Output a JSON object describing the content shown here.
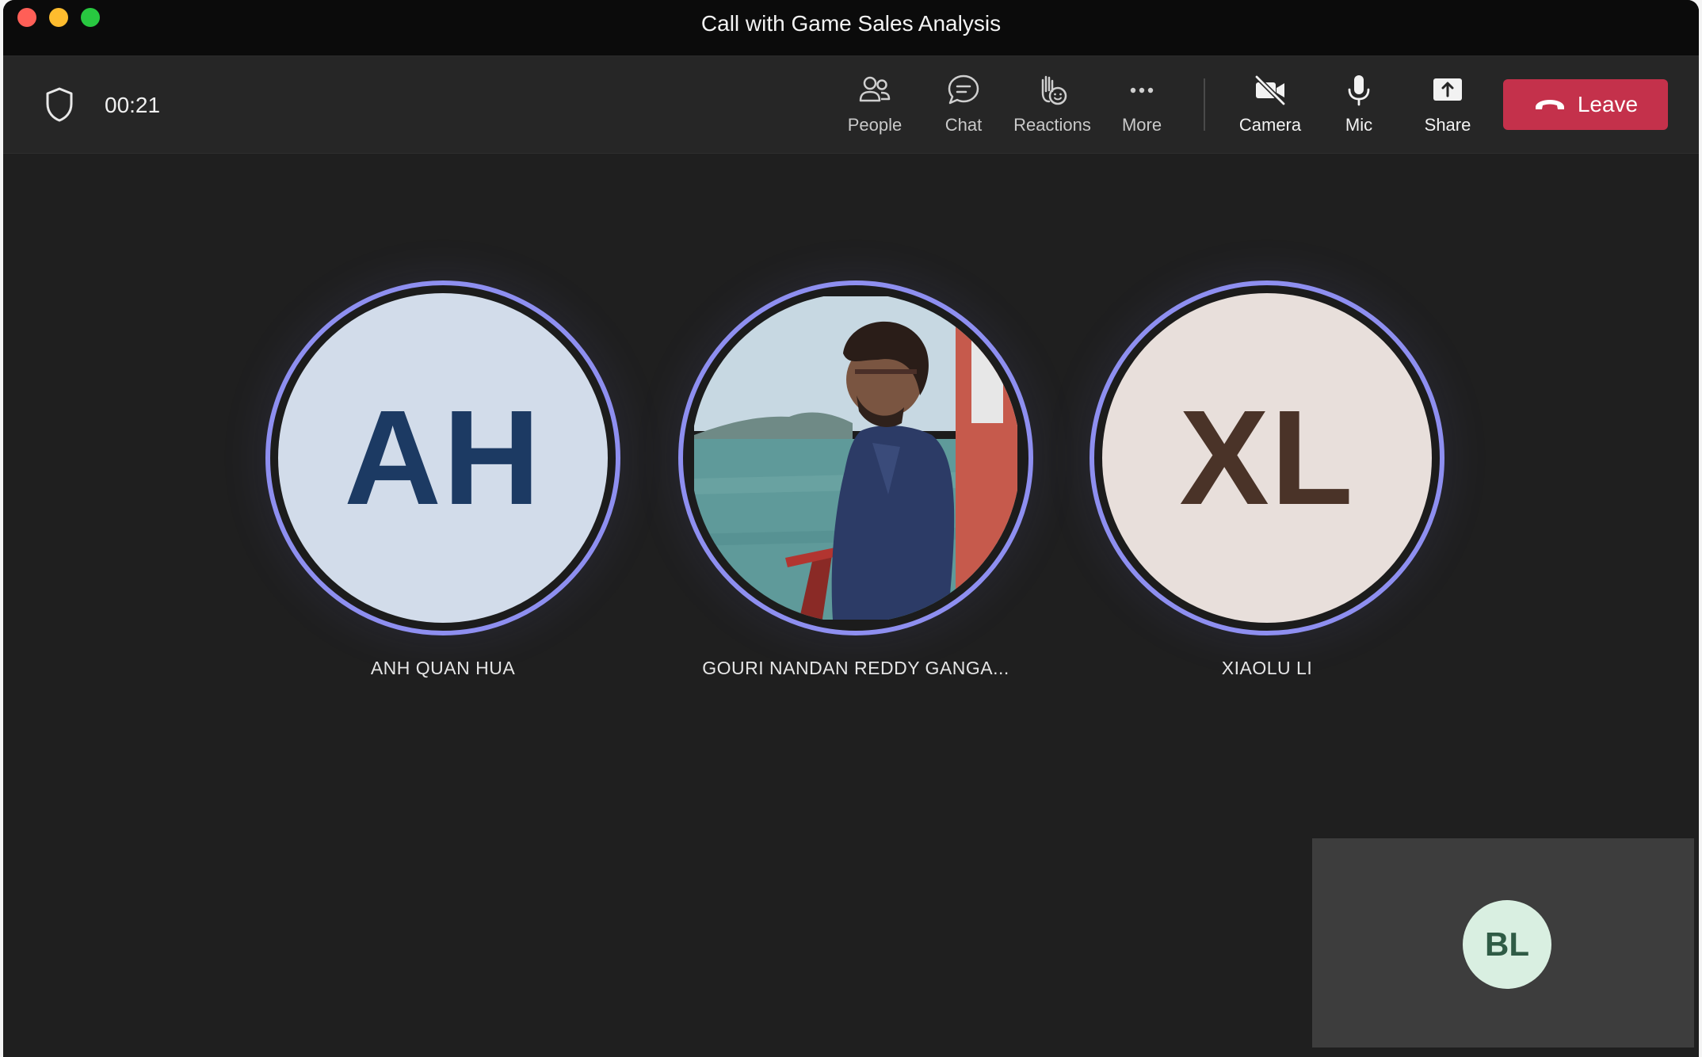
{
  "window": {
    "title": "Call with Game Sales Analysis"
  },
  "toolbar": {
    "timer": "00:21",
    "buttons": {
      "people": "People",
      "chat": "Chat",
      "reactions": "Reactions",
      "more": "More",
      "camera": "Camera",
      "mic": "Mic",
      "share": "Share"
    },
    "leave_label": "Leave"
  },
  "participants": [
    {
      "initials": "AH",
      "name": "ANH QUAN HUA",
      "bg": "#d2dcea",
      "fg": "#1c3a63"
    },
    {
      "initials": "",
      "name": "GOURI NANDAN REDDY GANGA...",
      "bg": "#6f93a8",
      "fg": "#ffffff"
    },
    {
      "initials": "XL",
      "name": "XIAOLU LI",
      "bg": "#e8dfdb",
      "fg": "#4a3328"
    }
  ],
  "self_view": {
    "initials": "BL",
    "bg": "#d9efe1",
    "fg": "#2f5b45"
  },
  "colors": {
    "accent_ring": "#8e8ff0",
    "leave": "#c4314b",
    "background": "#1f1f1f",
    "toolbar": "#262626"
  }
}
